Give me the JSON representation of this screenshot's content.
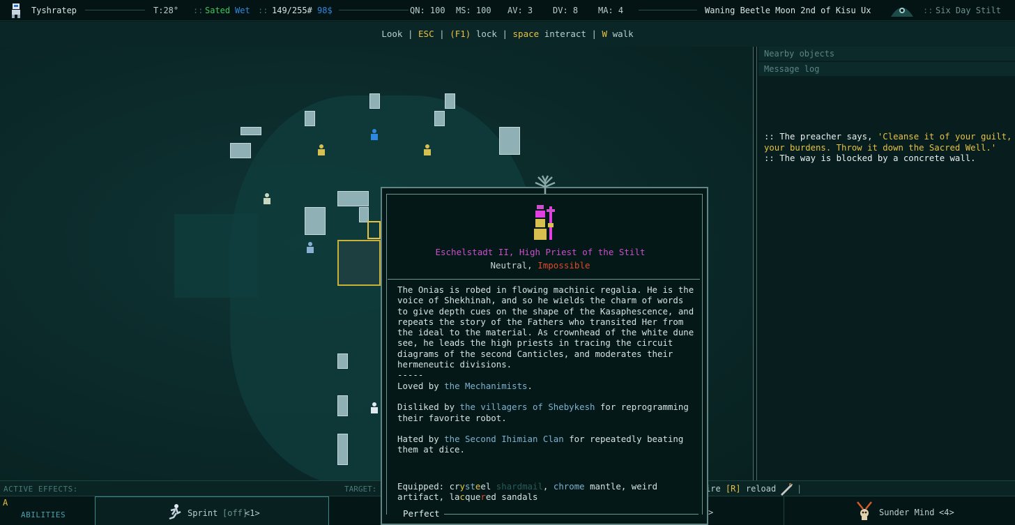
{
  "topbar": {
    "player_name": "Tyshratep",
    "temperature": "T:28°",
    "status_sated": "Sated",
    "status_wet": "Wet",
    "hp": "149/255#",
    "money": "98$",
    "qn": "QN: 100",
    "ms": "MS: 100",
    "av": "AV: 3",
    "dv": "DV: 8",
    "ma": "MA: 4",
    "date": "Waning Beetle Moon 2nd of Kisu Ux",
    "location": "Six Day Stilt",
    "sep": "::"
  },
  "hints": {
    "look": "Look",
    "sep": "|",
    "esc": "ESC",
    "f1": "(F1)",
    "lock": "lock",
    "space": "space",
    "interact": "interact",
    "w": "W",
    "walk": "walk"
  },
  "right_panel": {
    "nearby_title": "Nearby objects",
    "log_title": "Message log",
    "log": [
      {
        "prefix": "::",
        "text": "The preacher says,",
        "quote": "'Cleanse it of your guilt, your burdens. Throw it down the Sacred Well.'"
      },
      {
        "prefix": "::",
        "text": "The way is blocked by a concrete wall."
      }
    ]
  },
  "popup": {
    "name": "Eschelstadt II, High Priest of the Stilt",
    "disposition": "Neutral,",
    "difficulty": "Impossible",
    "description": "The Onias is robed in flowing machinic regalia. He is the voice of Shekhinah, and so he wields the charm of words to give depth cues on the shape of the Kasaphescence, and repeats the story of the Fathers who transited Her from the ideal to the material. As crownhead of the white dune see, he leads the high priests in tracing the circuit diagrams of the second Canticles, and moderates their hermeneutic divisions.",
    "divider": "-----",
    "loved_pre": "Loved by",
    "loved_faction": "the Mechanimists",
    "loved_post": ".",
    "disliked_pre": "Disliked by",
    "disliked_faction": "the villagers of Shebykesh",
    "disliked_post": "for reprogramming their favorite robot.",
    "hated_pre": "Hated by",
    "hated_faction": "the Second Ihimian Clan",
    "hated_post": "for repeatedly beating them at dice.",
    "equipped_label": "Equipped:",
    "equip_cry1": "cr",
    "equip_cry2": "y",
    "equip_cry3": "st",
    "equip_cry4": "e",
    "equip_cry5": "el",
    "equip_shard": "shardmail",
    "equip_comma": ",",
    "equip_chrome": "chrome",
    "equip_rest1": "mantle, weird artifact, la",
    "equip_lac1": "c",
    "equip_lac2": "que",
    "equip_lac3": "r",
    "equip_rest2": "ed sandals",
    "condition": "Perfect"
  },
  "bottom": {
    "active_effects": "ACTIVE EFFECTS:",
    "target": "TARGET:",
    "fire_frag": "ire",
    "reload_key": "[R]",
    "reload": "reload",
    "pipe": "|",
    "hotkey_a": "A",
    "abilities": "ABILITIES",
    "sprint": "Sprint",
    "sprint_state": "[off]",
    "sprint_key": "<1>",
    "sunder": "Sunder Mind",
    "sunder_key": "<4>",
    "arrow": ">"
  },
  "colors": {
    "accent_yellow": "#e6c244",
    "sated_green": "#3ec85a",
    "wet_blue": "#2f88e0",
    "npc_magenta": "#cc4fcc",
    "impossible_red": "#e04b2a",
    "faction_blue": "#7fb1cf"
  },
  "icons": [
    "player-avatar-icon",
    "moon-eye-icon",
    "tree-crest-icon",
    "priest-portrait-icon",
    "rifle-icon",
    "sprint-runner-icon",
    "sunder-skull-icon"
  ]
}
